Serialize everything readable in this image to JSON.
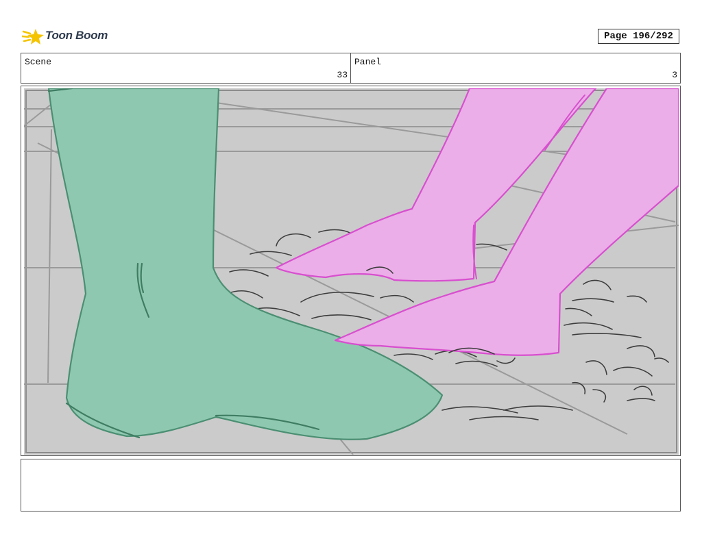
{
  "header": {
    "brand": "Toon Boom",
    "page_label": "Page 196/292"
  },
  "info": {
    "scene_label": "Scene",
    "scene_value": "33",
    "panel_label": "Panel",
    "panel_value": "3"
  },
  "colors": {
    "background_gray": "#cbcbcb",
    "green_foot": "#8fc8b0",
    "pink_feet": "#ebaee8",
    "logo_yellow": "#f5c400"
  },
  "notes": {
    "text": ""
  }
}
